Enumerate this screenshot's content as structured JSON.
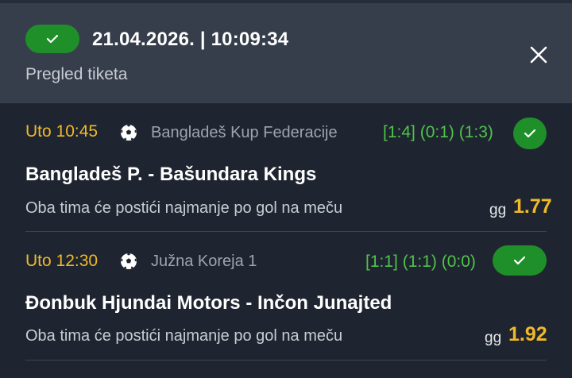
{
  "ticket": {
    "datetime": "21.04.2026. | 10:09:34",
    "subtitle": "Pregled tiketa",
    "status_color": "#1f8f2a",
    "close_icon": "close-icon"
  },
  "matches": [
    {
      "time": "Uto 10:45",
      "sport_icon": "soccer-ball-icon",
      "league": "Bangladeš Kup Federacije",
      "score": "[1:4] (0:1) (1:3)",
      "teams": "Bangladeš P. - Bašundara Kings",
      "market": "Oba tima će postići najmanje po gol na meču",
      "pick": "gg",
      "odds": "1.77",
      "won": true
    },
    {
      "time": "Uto 12:30",
      "sport_icon": "soccer-ball-icon",
      "league": "Južna Koreja 1",
      "score": "[1:1] (1:1) (0:0)",
      "teams": "Đonbuk Hjundai Motors - Inčon Junajted",
      "market": "Oba tima će postići najmanje po gol na meču",
      "pick": "gg",
      "odds": "1.92",
      "won": true
    }
  ],
  "colors": {
    "accent_yellow": "#f0b928",
    "score_green": "#4fc34a",
    "header_bg": "#363e4b",
    "body_bg": "#1f2530"
  }
}
